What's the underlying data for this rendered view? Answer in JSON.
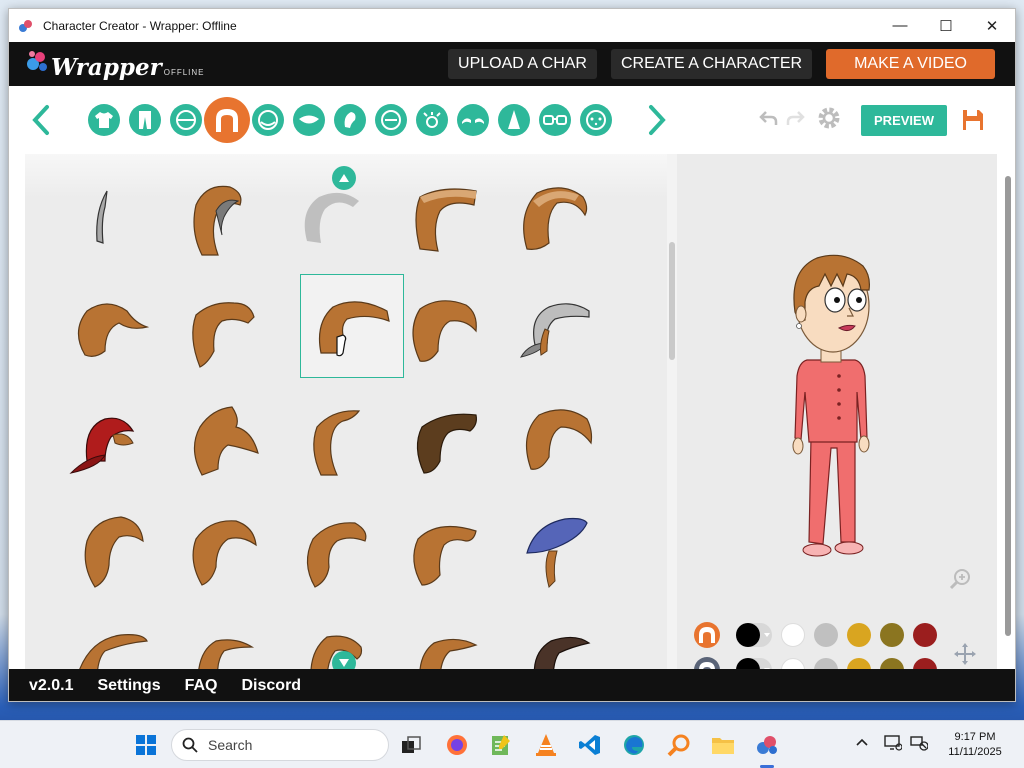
{
  "window": {
    "title": "Character Creator - Wrapper: Offline",
    "controls": {
      "minimize": "—",
      "maximize": "☐",
      "close": "✕"
    }
  },
  "header": {
    "logo_main": "Wrapper",
    "logo_sub": "OFFLINE",
    "buttons": {
      "upload": "UPLOAD A CHAR",
      "create": "CREATE A CHARACTER",
      "make_video": "MAKE A VIDEO"
    }
  },
  "toolbar": {
    "categories": [
      "shirt-icon",
      "pants-icon",
      "face-shape-icon",
      "hair-icon",
      "head-icon",
      "mouth-icon",
      "ear-icon",
      "face-icon",
      "eyes-icon",
      "eyebrows-icon",
      "nose-icon",
      "glasses-icon",
      "mole-icon"
    ],
    "active_category": "hair-icon",
    "preview_label": "PREVIEW"
  },
  "hair_grid": {
    "rows": 5,
    "cols": 5,
    "selected_index": 7,
    "colors": {
      "brown": "#b87333",
      "dark_brown": "#5c3d1e",
      "grey": "#a8a8a8",
      "red": "#b01c1c",
      "blue": "#5565b8",
      "darkest": "#4a3328"
    }
  },
  "palette": {
    "row1": [
      "#000000",
      "#ffffff",
      "#c0c0c0",
      "#d9a520",
      "#8b7520",
      "#9b1e1e"
    ],
    "row2": [
      "#000000",
      "#ffffff",
      "#c0c0c0",
      "#d9a520",
      "#8b7520",
      "#9b1e1e"
    ]
  },
  "footer": {
    "version": "v2.0.1",
    "settings": "Settings",
    "faq": "FAQ",
    "discord": "Discord"
  },
  "taskbar": {
    "search_placeholder": "Search",
    "time": "9:17 PM",
    "date": "11/11/2025"
  },
  "accent": "#2eb89a",
  "accent_orange": "#e06a2b"
}
